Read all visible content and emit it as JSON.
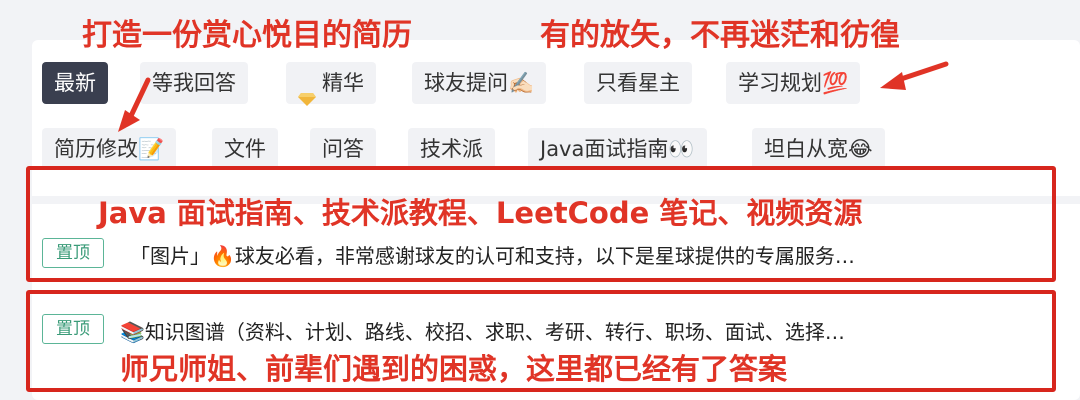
{
  "annotations": {
    "top_left": "打造一份赏心悦目的简历",
    "top_right": "有的放矢，不再迷茫和彷徨",
    "box1": "Java 面试指南、技术派教程、LeetCode 笔记、视频资源",
    "box2": "师兄师姐、前辈们遇到的困惑，这里都已经有了答案"
  },
  "tabs_row1": [
    {
      "label": "最新",
      "active": true
    },
    {
      "label": "等我回答",
      "active": false
    },
    {
      "label": "精华",
      "icon": "diamond-icon",
      "active": false
    },
    {
      "label": "球友提问✍🏻",
      "active": false
    },
    {
      "label": "只看星主",
      "active": false
    },
    {
      "label": "学习规划💯",
      "active": false
    }
  ],
  "tabs_row2": [
    {
      "label": "简历修改📝"
    },
    {
      "label": "文件"
    },
    {
      "label": "问答"
    },
    {
      "label": "技术派"
    },
    {
      "label": "Java面试指南👀"
    },
    {
      "label": "坦白从宽😂"
    }
  ],
  "posts": [
    {
      "badge": "置顶",
      "text": "「图片」🔥球友必看，非常感谢球友的认可和支持，以下是星球提供的专属服务…"
    },
    {
      "badge": "置顶",
      "text": "📚知识图谱（资料、计划、路线、校招、求职、考研、转行、职场、面试、选择…"
    }
  ],
  "colors": {
    "accent_red": "#d7261d",
    "pin_green": "#3a9b78",
    "active_tab": "#3a3f4f"
  }
}
